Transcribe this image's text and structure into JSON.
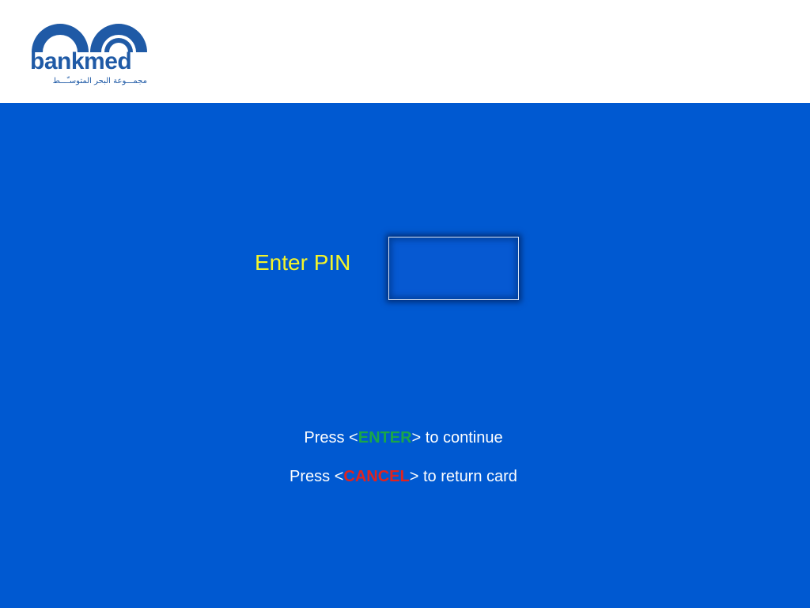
{
  "header": {
    "logo": {
      "wordmark": "bankmed",
      "tagline_arabic": "مجمـــوعة البحر المتوسـّـــط",
      "brand_color": "#1f5aa6",
      "icon": "double-arch-logo-icon"
    }
  },
  "main": {
    "background_color": "#0059d1",
    "pin_prompt": {
      "label": "Enter PIN",
      "label_color": "#f4f42a",
      "value": ""
    },
    "instructions": [
      {
        "prefix": "Press <",
        "keyword": "ENTER",
        "keyword_color": "#1aa64a",
        "suffix": "> to continue"
      },
      {
        "prefix": "Press <",
        "keyword": "CANCEL",
        "keyword_color": "#e0231f",
        "suffix": "> to return card"
      }
    ]
  }
}
